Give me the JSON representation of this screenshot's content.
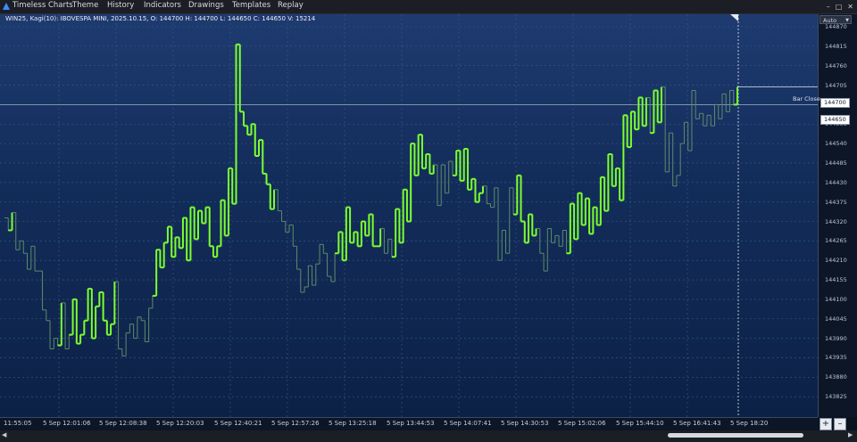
{
  "menu": {
    "app_name": "Timeless Charts",
    "items": [
      "Theme",
      "History",
      "Indicators",
      "Drawings",
      "Templates",
      "Replay"
    ]
  },
  "window_controls": [
    "–",
    "□",
    "✕"
  ],
  "info_line": "WIN25, Kagi(10): IBOVESPA MINI, 2025.10.15, O: 144700 H: 144700 L: 144650 C: 144650 V: 15214",
  "price_axis": {
    "mode": "Auto",
    "ticks": [
      "144870",
      "144815",
      "144760",
      "144705",
      "144650",
      "144595",
      "144540",
      "144485",
      "144430",
      "144375",
      "144320",
      "144265",
      "144210",
      "144155",
      "144100",
      "144045",
      "143990",
      "143935",
      "143880",
      "143825"
    ],
    "bar_close_label": "Bar Close",
    "bar_close_price": "144700",
    "last_price": "144650"
  },
  "time_axis": {
    "labels": [
      "11:55:05",
      "5 Sep 12:01:06",
      "5 Sep 12:08:38",
      "5 Sep 12:20:03",
      "5 Sep 12:40:21",
      "5 Sep 12:57:26",
      "5 Sep 13:25:18",
      "5 Sep 13:44:53",
      "5 Sep 14:07:41",
      "5 Sep 14:30:53",
      "5 Sep 15:02:06",
      "5 Sep 15:44:10",
      "5 Sep 16:41:43",
      "5 Sep 18:20"
    ]
  },
  "zoom": {
    "plus": "+",
    "minus": "–"
  },
  "scroll": {
    "left": "◀",
    "right": "▶"
  },
  "colors": {
    "yang": "#7cff2e",
    "yin": "#5f8a6a",
    "grid": "#3e5a88",
    "price_line": "#9fb0c8"
  },
  "chart_data": {
    "type": "kagi",
    "y_range": [
      143800,
      144900
    ],
    "values": [
      144330,
      144295,
      144345,
      144240,
      144265,
      144230,
      144185,
      144250,
      144180,
      144180,
      144070,
      144040,
      143960,
      143990,
      143970,
      144090,
      143960,
      144000,
      144100,
      143975,
      144000,
      144040,
      144130,
      143990,
      144080,
      144120,
      144040,
      144000,
      144030,
      144150,
      143960,
      143940,
      144005,
      144030,
      143990,
      144050,
      144040,
      143980,
      144075,
      144110,
      144240,
      144190,
      144260,
      144305,
      144220,
      144275,
      144245,
      144330,
      144210,
      144360,
      144270,
      144350,
      144315,
      144360,
      144250,
      144220,
      144250,
      144380,
      144280,
      144470,
      144370,
      144820,
      144630,
      144590,
      144565,
      144595,
      144505,
      144550,
      144455,
      144425,
      144355,
      144410,
      144350,
      144320,
      144290,
      144310,
      144250,
      144185,
      144120,
      144135,
      144195,
      144140,
      144200,
      144255,
      144230,
      144165,
      144150,
      144230,
      144290,
      144210,
      144360,
      144260,
      144290,
      144250,
      144320,
      144280,
      144340,
      144250,
      144250,
      144300,
      144230,
      144270,
      144220,
      144355,
      144260,
      144410,
      144320,
      144540,
      144450,
      144565,
      144470,
      144510,
      144455,
      144480,
      144365,
      144480,
      144400,
      144490,
      144450,
      144520,
      144435,
      144525,
      144410,
      144440,
      144375,
      144400,
      144420,
      144370,
      144360,
      144415,
      144210,
      144295,
      144230,
      144415,
      144340,
      144450,
      144320,
      144260,
      144340,
      144280,
      144300,
      144230,
      144180,
      144300,
      144260,
      144280,
      144250,
      144295,
      144230,
      144370,
      144270,
      144400,
      144310,
      144385,
      144285,
      144360,
      144310,
      144445,
      144350,
      144510,
      144420,
      144470,
      144380,
      144620,
      144530,
      144630,
      144580,
      144670,
      144590,
      144670,
      144570,
      144690,
      144600,
      144700,
      144460,
      144570,
      144420,
      144450,
      144540,
      144600,
      144520,
      144690,
      144610,
      144625,
      144590,
      144620,
      144590,
      144650,
      144610,
      144680,
      144630,
      144690,
      144650,
      144700
    ]
  }
}
